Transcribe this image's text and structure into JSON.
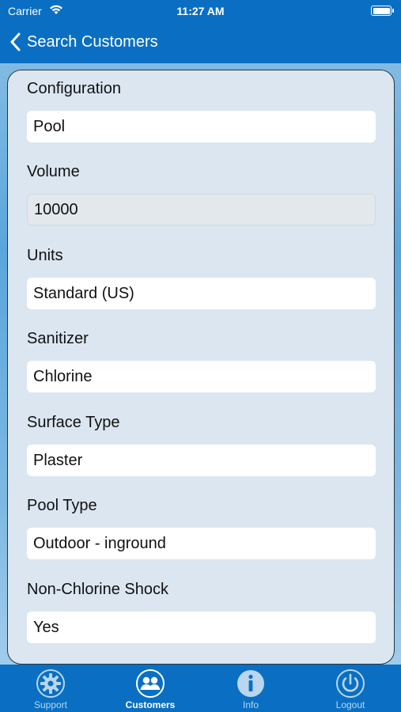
{
  "status_bar": {
    "carrier": "Carrier",
    "time": "11:27 AM"
  },
  "nav": {
    "back_label": "Search Customers"
  },
  "fields": [
    {
      "label": "Configuration",
      "value": "Pool"
    },
    {
      "label": "Volume",
      "value": "10000"
    },
    {
      "label": "Units",
      "value": "Standard (US)"
    },
    {
      "label": "Sanitizer",
      "value": "Chlorine"
    },
    {
      "label": "Surface Type",
      "value": "Plaster"
    },
    {
      "label": "Pool Type",
      "value": "Outdoor - inground"
    },
    {
      "label": "Non-Chlorine Shock",
      "value": "Yes"
    }
  ],
  "tabs": [
    {
      "label": "Support",
      "icon": "gear-icon"
    },
    {
      "label": "Customers",
      "icon": "customers-icon",
      "active": true
    },
    {
      "label": "Info",
      "icon": "info-icon"
    },
    {
      "label": "Logout",
      "icon": "power-icon"
    }
  ],
  "colors": {
    "brand": "#0a6fc2",
    "card": "#dbe6f1"
  }
}
